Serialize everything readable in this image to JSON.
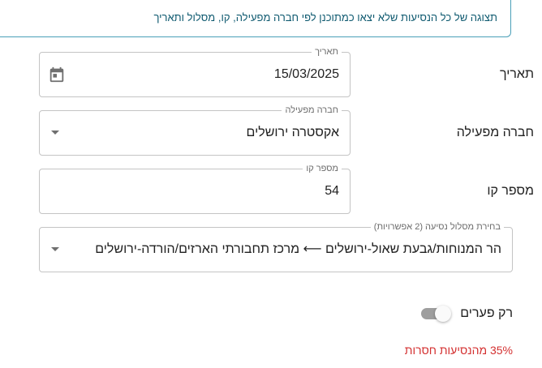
{
  "banner": {
    "text": "תצוגה של כל הנסיעות שלא יצאו כמתוכנן לפי חברה מפעילה, קו, מסלול ותאריך"
  },
  "date": {
    "label": "תאריך",
    "legend": "תאריך",
    "value": "15/03/2025",
    "icon": "calendar-icon"
  },
  "operator": {
    "label": "חברה מפעילה",
    "legend": "חברה מפעילה",
    "value": "אקסטרה ירושלים",
    "icon": "chevron-down-icon"
  },
  "line": {
    "label": "מספר קו",
    "legend": "מספר קו",
    "value": "54"
  },
  "route": {
    "legend": "בחירת מסלול נסיעה (2 אפשרויות)",
    "value": "הר המנוחות/גבעת שאול-ירושלים ⟵ מרכז תחבורתי הארזים/הורדה-ירושלים",
    "icon": "chevron-down-icon"
  },
  "toggle": {
    "label": "רק פערים",
    "checked": false
  },
  "stats": {
    "missing_text": "35% מהנסיעות חסרות"
  },
  "colors": {
    "banner_border": "#4a9fb8",
    "banner_text": "#0f5a70",
    "error_text": "#d32f2f",
    "field_border": "#c4c4c4"
  }
}
